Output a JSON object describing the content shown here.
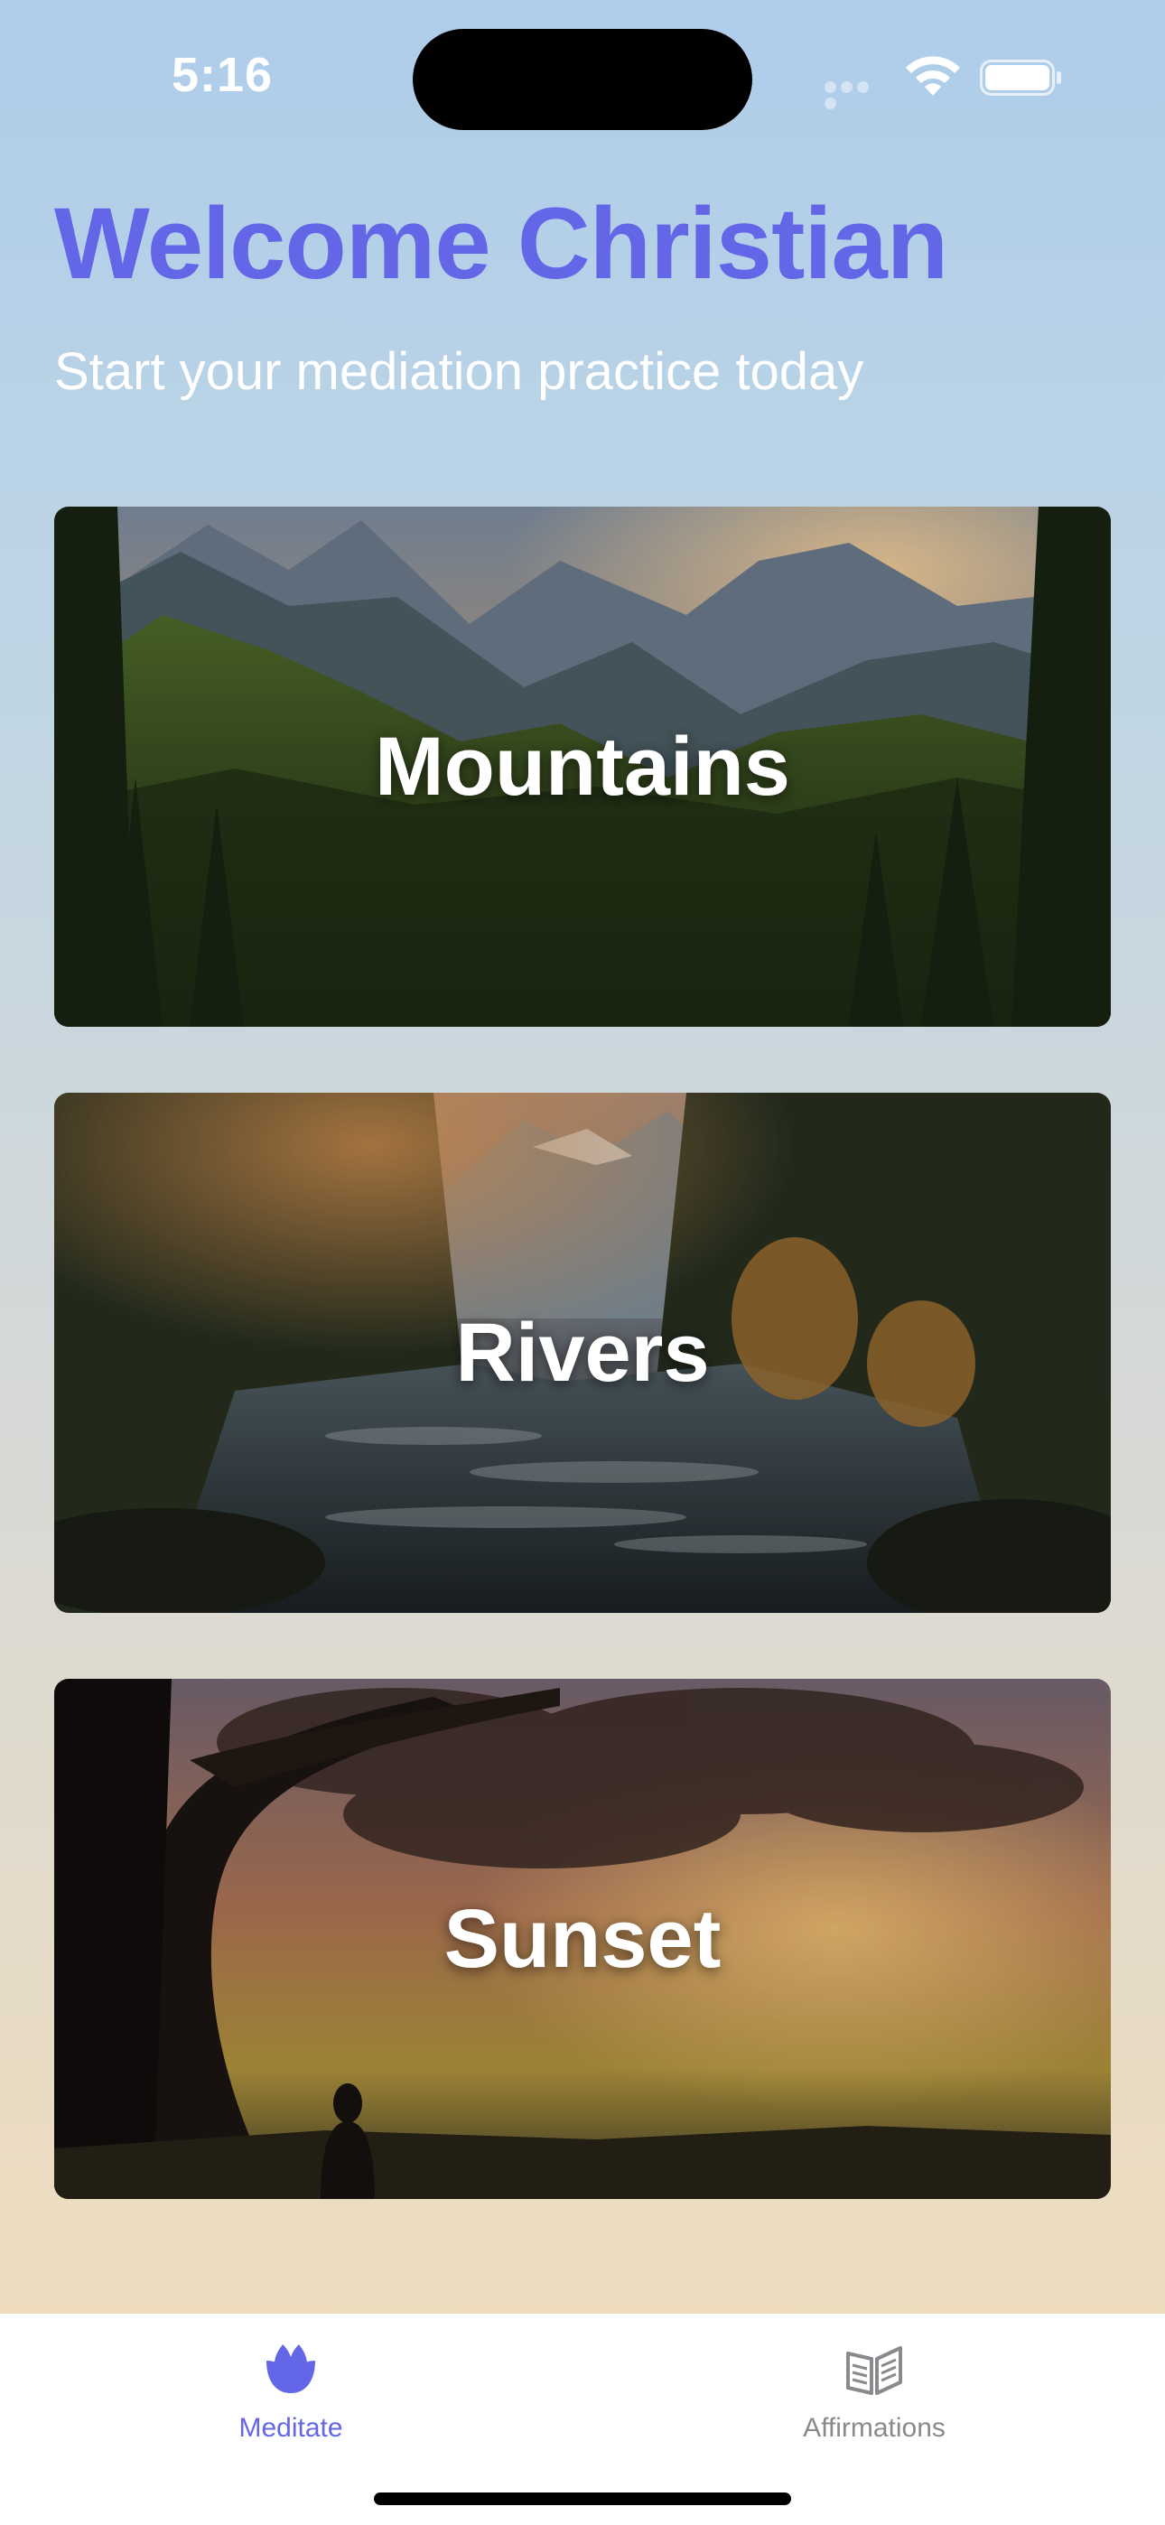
{
  "status_bar": {
    "time": "5:16",
    "icons": [
      "cellular-signal-icon",
      "wifi-icon",
      "battery-icon"
    ]
  },
  "header": {
    "title": "Welcome Christian",
    "subtitle": "Start your mediation practice today"
  },
  "cards": [
    {
      "label": "Mountains",
      "image": "mountain-forest-landscape"
    },
    {
      "label": "Rivers",
      "image": "forest-river-landscape"
    },
    {
      "label": "Sunset",
      "image": "tree-sunset-meditation-landscape"
    }
  ],
  "tab_bar": {
    "tabs": [
      {
        "label": "Meditate",
        "icon": "tulip-icon",
        "selected": true
      },
      {
        "label": "Affirmations",
        "icon": "open-book-icon",
        "selected": false
      }
    ]
  },
  "colors": {
    "accent": "#6466e8",
    "inactive_tab": "#8a8a8e",
    "background_top": "#aecdea",
    "background_bottom": "#f2dfc0"
  }
}
